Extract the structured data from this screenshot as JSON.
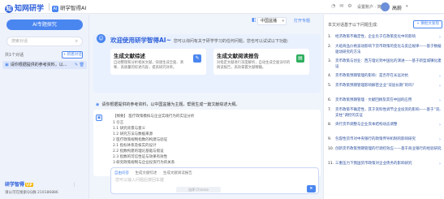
{
  "header": {
    "logo_mark": "知",
    "logo_text": "知网研学",
    "sub_app_mark": "AI",
    "sub_app": "研学智得AI",
    "icons": [
      "bell-icon",
      "message-icon",
      "settings-icon"
    ],
    "lang": "设置账户 · 简约",
    "user_name": "高蔚",
    "dropdown": "▾"
  },
  "sidebar": {
    "ai_button": "AI专题探究",
    "search_placeholder": "搜索对话",
    "search_icon": "⌕",
    "count_label": "共1个对话",
    "new_button": "+ 新建对话",
    "chat_items": [
      {
        "icon": "▣",
        "title": "请你根据提供的参考资料，以...",
        "actions": "✎ 🗑"
      }
    ],
    "brand": "研学智得",
    "vip": "VIP",
    "more": "⋮",
    "qq": "请以可在搜索QQ群 210186886"
  },
  "main": {
    "topic_icon": "◧",
    "topic_select": "中国盆播",
    "topic_dd": "▾",
    "open_button": "打开专题",
    "welcome": {
      "robot": "☺",
      "title": "欢迎使用研学智得AI~",
      "subtitle": "您可以询问有关于研学学习的任何问题，您也可以试试以下功能:",
      "cards": [
        {
          "title": "生成文献综述",
          "desc": "自动整理和分析相关文献，快速生成全面、清晰、高质量的综述内容，提高研究效率。",
          "icon": "✎",
          "color": "#4a86f0"
        },
        {
          "title": "生成文献阅读报告",
          "desc": "对指定文献进行深度解析，自动生成全面详尽的阅读报告，高效掌握文献精髓。",
          "icon": "▤",
          "color": "#2eae5e"
        }
      ]
    },
    "prompt": {
      "icon": "◉",
      "text": "请你根据提供的参考资料，以中国盆播为主题，帮我生成一篇文献综述大纲。"
    },
    "reply": {
      "icon": "▣",
      "lines": [
        "【纲要】 医疗政策模拟与企业实践行为的实证分析",
        "1 引言",
        "1.1 研究背景与意义",
        "1.2 研究方法与数据来源",
        "2 医疗政策规制指数的构建与验证",
        "2.1 指标体系及核实的设计",
        "2.2 指数构建的理论基础与假设",
        "2.3 指数的可信性证与效果有效性",
        "3 研究政策规制与企业投资行为的关系"
      ]
    },
    "input": {
      "tabs": [
        "自由问答",
        "生成文献综述",
        "生成文献阅读报告"
      ],
      "placeholder": "您可以输入问题后按回车键",
      "ghost": "选择 Chrome",
      "send": "➤"
    }
  },
  "right_panel": {
    "title": "本文对话基于以下问题生成:",
    "refresh": "+ 换批文发现",
    "arrow": "›",
    "questions": [
      {
        "n": "1.",
        "text": "经济政策不确定性，企业负于在政策变化中的影响"
      },
      {
        "n": "2.",
        "text": "大班商品价格波动影响下货币政策的变化与反应规律——基于数据驱动研究的方法"
      },
      {
        "n": "3.",
        "text": "货币政策与创业：西方理论到中国化的演进——基于新型城镇化建设"
      },
      {
        "n": "4.",
        "text": "货币政策预期管理的影响：是否存在长远对抗"
      },
      {
        "n": "5.",
        "text": "货币政策预期管理影响解密企业“双层长期”的吗？"
      },
      {
        "n": "6.",
        "text": "货币政策预期管理 · 文献回顾及其在中国的应用"
      },
      {
        "n": "7.",
        "text": "货币政策不确定性，其于资料性调节企业投资的影响——基于“双支柱”调控的实证"
      },
      {
        "n": "8.",
        "text": "央行货币调整与企业资本结构动态调整"
      },
      {
        "n": "9.",
        "text": "包容性货币对中央银行的政策传导机制的影响研究"
      },
      {
        "n": "10.",
        "text": "创新货币政策预期管理的行调控效应——基于商业银行的经验研究"
      },
      {
        "n": "11.",
        "text": "三重压力下我国货币政策对企业债务的影响研究"
      }
    ]
  }
}
